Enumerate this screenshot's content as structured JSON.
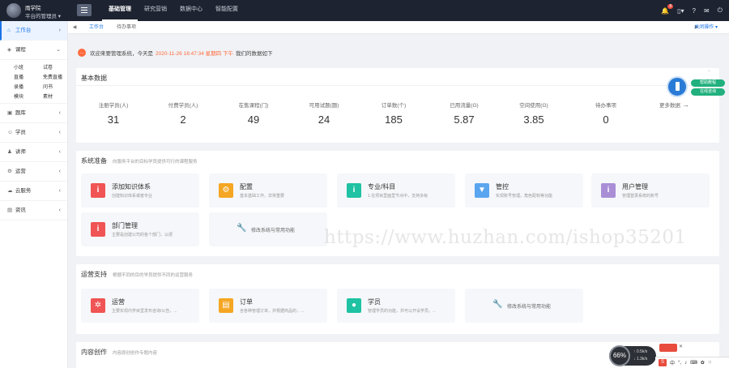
{
  "topbar": {
    "user_name": "雨学院",
    "user_role": "平台的管理员",
    "nav": [
      "基础管理",
      "研究营销",
      "数据中心",
      "智能配置"
    ],
    "notification_count": "8"
  },
  "sidebar": {
    "items": [
      {
        "icon": "home-icon",
        "label": "工作台",
        "active": true
      },
      {
        "icon": "tag-icon",
        "label": "课程"
      },
      {
        "icon": "folder-icon",
        "label": "题库"
      },
      {
        "icon": "user-icon",
        "label": "学员"
      },
      {
        "icon": "teacher-icon",
        "label": "讲师"
      },
      {
        "icon": "gear-icon",
        "label": "运营"
      },
      {
        "icon": "cloud-icon",
        "label": "云服务"
      },
      {
        "icon": "news-icon",
        "label": "资讯"
      }
    ],
    "course_sub": [
      "小班",
      "试卷",
      "直播",
      "免费直播",
      "录播",
      "问书",
      "模块",
      "素材"
    ]
  },
  "tabs": {
    "items": [
      "工作台",
      "待办事项"
    ],
    "close_label": "关闭操作"
  },
  "welcome": {
    "prefix": "欢迎来要管理系统，今天是",
    "date": "2020-11-26 16:47:34 星期四 下午",
    "suffix": "我们的数据如下"
  },
  "basic": {
    "title": "基本数据",
    "stats": [
      {
        "label": "注册学员(人)",
        "value": "31"
      },
      {
        "label": "付费学员(人)",
        "value": "2"
      },
      {
        "label": "在售课程(门)",
        "value": "49"
      },
      {
        "label": "可用试题(题)",
        "value": "24"
      },
      {
        "label": "订单数(个)",
        "value": "185"
      },
      {
        "label": "已用流量(G)",
        "value": "5.87"
      },
      {
        "label": "空间使用(G)",
        "value": "3.85"
      },
      {
        "label": "待办事项",
        "value": "0"
      }
    ],
    "more": "更多数据"
  },
  "prep": {
    "title": "系统准备",
    "subtitle": "向服务平台的目标学员提供可行的课程服务",
    "tiles": [
      {
        "name": "添加知识体系",
        "desc": "创建知识体系或者专业",
        "color": "#f05454",
        "glyph": "i"
      },
      {
        "name": "配置",
        "desc": "基本基础工作，非常重要",
        "color": "#f5a623",
        "glyph": "⚙"
      },
      {
        "name": "专业/科目",
        "desc": "1.在项目里面里节点中，支持多级",
        "color": "#1fc2a3",
        "glyph": "i"
      },
      {
        "name": "管控",
        "desc": "实现账号管理，角色配权等功能",
        "color": "#5aa5f0",
        "glyph": "▼"
      },
      {
        "name": "用户管理",
        "desc": "管理登录系统的账号",
        "color": "#a98ed6",
        "glyph": "i"
      },
      {
        "name": "部门管理",
        "desc": "主要是创建公司的各个部门，以便",
        "color": "#f05454",
        "glyph": "i"
      }
    ],
    "extra": "修改系统与常用功能"
  },
  "ops": {
    "title": "运营支持",
    "subtitle": "根据不同的目的学员提供不同的运营服务",
    "tiles": [
      {
        "name": "运营",
        "desc": "主要实现内学目里发布咨询/公告，...",
        "color": "#f05454",
        "glyph": "✲"
      },
      {
        "name": "订单",
        "desc": "含各种管理订单，并根据商品的，...",
        "color": "#f5a623",
        "glyph": "▤"
      },
      {
        "name": "学员",
        "desc": "管理学员的功能，并可以开设学员，...",
        "color": "#1fc2a3",
        "glyph": "●"
      }
    ],
    "extra": "修改系统与常用功能"
  },
  "content_card": {
    "title": "内容创作",
    "subtitle": "内容原创创作专题内容"
  },
  "watermark": "https://www.huzhan.com/ishop35201",
  "float_help": {
    "guide": "帮助教程",
    "support": "在线咨询"
  },
  "speed": {
    "percent": "66%",
    "up": "0.5k/s",
    "down": "1.3k/s"
  },
  "ime": {
    "label": "中"
  }
}
